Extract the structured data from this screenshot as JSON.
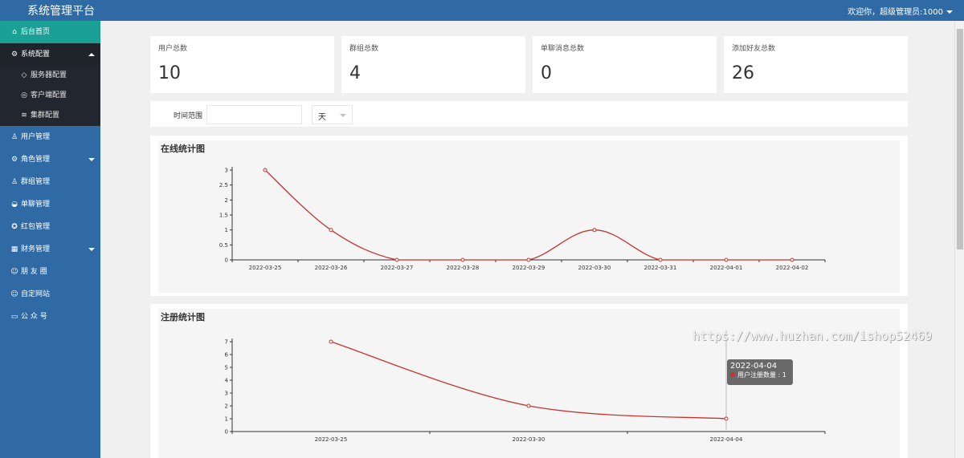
{
  "app": {
    "title": "系统管理平台",
    "welcome": "欢迎你，超级管理员:1000"
  },
  "sidebar": {
    "home": "后台首页",
    "system_config": {
      "label": "系统配置",
      "children": [
        "服务器配置",
        "客户端配置",
        "集群配置"
      ]
    },
    "user_mgmt": "用户管理",
    "role_mgmt": "角色管理",
    "group_mgmt": "群组管理",
    "chat_mgmt": "单聊管理",
    "redpacket_mgmt": "红包管理",
    "finance_mgmt": "财务管理",
    "moments": "朋 友 圈",
    "custom_site": "自定网站",
    "official_account": "公 众 号"
  },
  "stats": [
    {
      "label": "用户总数",
      "value": "10"
    },
    {
      "label": "群组总数",
      "value": "4"
    },
    {
      "label": "单聊消息总数",
      "value": "0"
    },
    {
      "label": "添加好友总数",
      "value": "26"
    }
  ],
  "filter": {
    "label": "时间范围",
    "input_value": "",
    "unit": "天"
  },
  "charts": {
    "online_title": "在线统计图",
    "register_title": "注册统计图"
  },
  "tooltip": {
    "date": "2022-04-04",
    "series": "用户注册数量",
    "value": "1",
    "row": "用户注册数量 : 1"
  },
  "watermark": "https://www.huzhan.com/ishop52469",
  "chart_data": [
    {
      "type": "line",
      "title": "在线统计图",
      "x": [
        "2022-03-25",
        "2022-03-26",
        "2022-03-27",
        "2022-03-28",
        "2022-03-29",
        "2022-03-30",
        "2022-03-31",
        "2022-04-01",
        "2022-04-02"
      ],
      "values": [
        3,
        1,
        0,
        0,
        0,
        1,
        0,
        0,
        0
      ],
      "ylim": [
        0,
        3
      ],
      "yticks": [
        "0",
        "0.5",
        "1",
        "1.5",
        "2",
        "2.5",
        "3"
      ],
      "smooth": true,
      "color": "#c23531"
    },
    {
      "type": "line",
      "title": "注册统计图",
      "x": [
        "2022-03-25",
        "2022-03-30",
        "2022-04-04"
      ],
      "values": [
        7,
        2,
        1
      ],
      "ylim": [
        0,
        7
      ],
      "yticks": [
        "0",
        "1",
        "2",
        "3",
        "4",
        "5",
        "6",
        "7"
      ],
      "smooth": true,
      "color": "#c23531",
      "series_name": "用户注册数量"
    }
  ]
}
